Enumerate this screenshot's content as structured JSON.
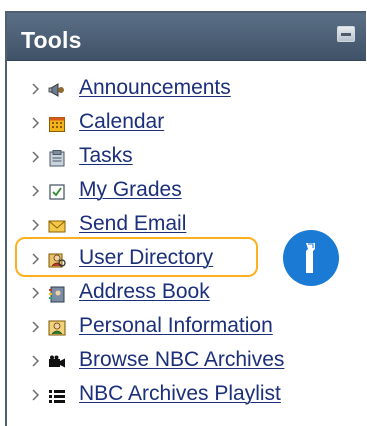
{
  "panel": {
    "title": "Tools"
  },
  "tools": [
    {
      "label": "Announcements",
      "icon": "megaphone-icon"
    },
    {
      "label": "Calendar",
      "icon": "calendar-icon"
    },
    {
      "label": "Tasks",
      "icon": "clipboard-icon"
    },
    {
      "label": "My Grades",
      "icon": "grades-icon"
    },
    {
      "label": "Send Email",
      "icon": "envelope-icon"
    },
    {
      "label": "User Directory",
      "icon": "user-directory-icon"
    },
    {
      "label": "Address Book",
      "icon": "address-book-icon"
    },
    {
      "label": "Personal Information",
      "icon": "personal-info-icon"
    },
    {
      "label": "Browse NBC Archives",
      "icon": "camera-icon"
    },
    {
      "label": "NBC Archives Playlist",
      "icon": "list-icon"
    }
  ],
  "callout": {
    "highlighted_item": "User Directory",
    "icon": "info-icon",
    "colors": {
      "highlight": "#ffb020",
      "badge": "#1b7bd4"
    }
  },
  "colors": {
    "header": "#4b5d72",
    "link": "#1b2f7a"
  }
}
